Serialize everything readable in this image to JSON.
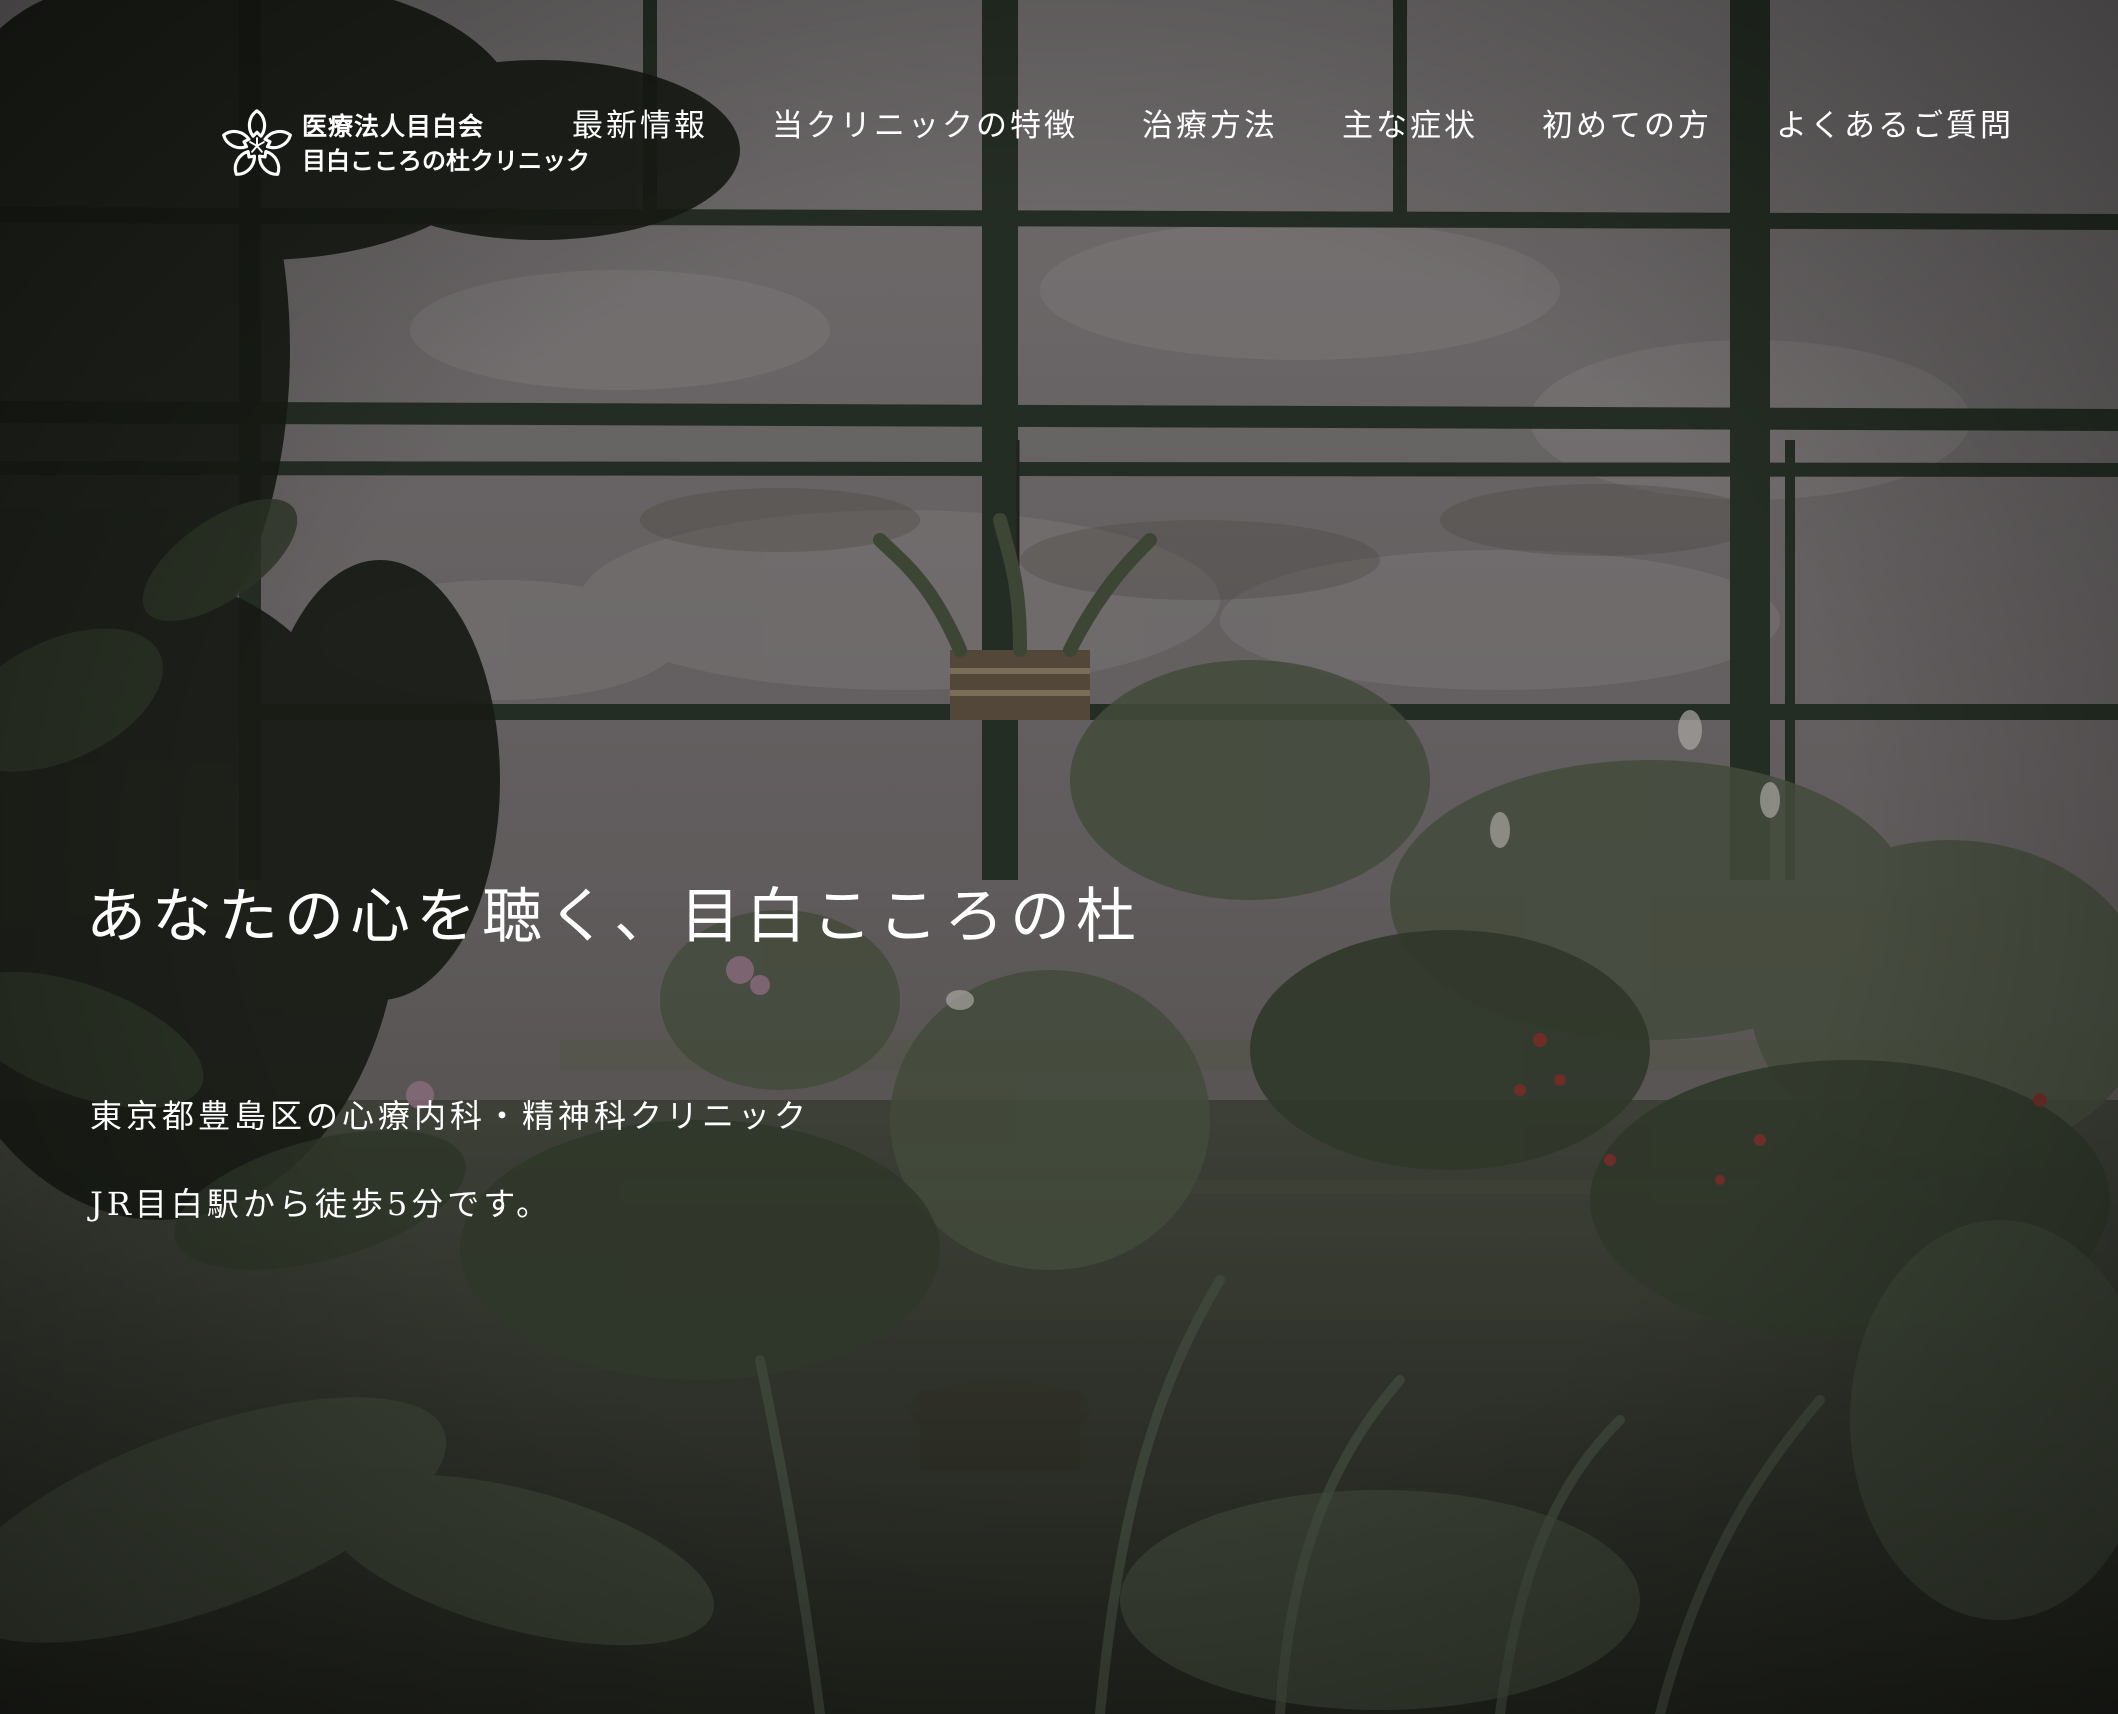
{
  "logo": {
    "line1": "医療法人目白会",
    "line2": "目白こころの杜クリニック",
    "icon": "sakura-flower-icon"
  },
  "nav": {
    "items": [
      {
        "label": "最新情報"
      },
      {
        "label": "当クリニックの特徴"
      },
      {
        "label": "治療方法"
      },
      {
        "label": "主な症状"
      },
      {
        "label": "初めての方"
      },
      {
        "label": "よくあるご質問"
      }
    ]
  },
  "hero": {
    "title": "あなたの心を聴く、目白こころの杜",
    "lines": [
      "東京都豊島区の心療内科・精神科クリニック",
      "JR目白駅から徒歩5分です。"
    ]
  },
  "colors": {
    "text": "#ffffff",
    "frame": "#2f3a2e",
    "sky": "#8a8486",
    "foliage": "#3c4536"
  }
}
